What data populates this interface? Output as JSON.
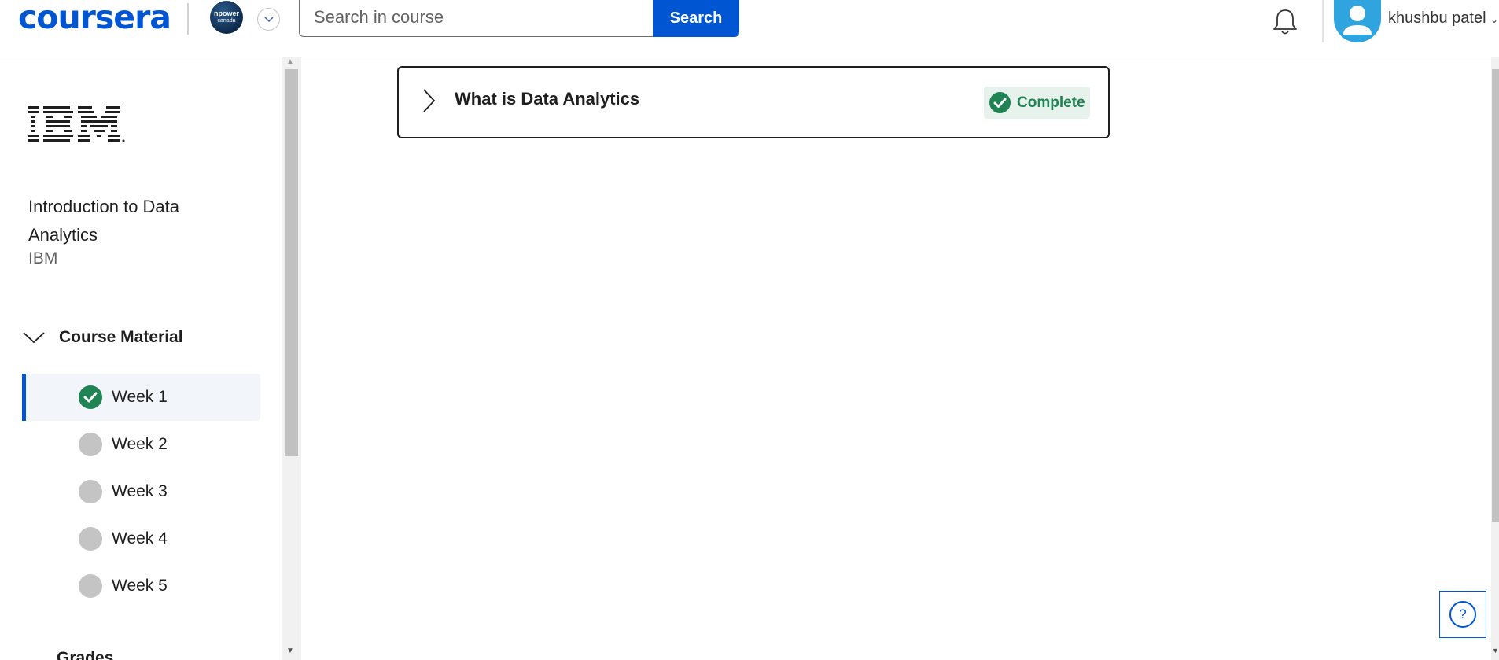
{
  "header": {
    "logo_text": "coursera",
    "partner_badge": {
      "line1": "npower",
      "line2": "canada"
    },
    "search": {
      "placeholder": "Search in course",
      "button_label": "Search"
    },
    "user": {
      "name": "khushbu patel"
    }
  },
  "sidebar": {
    "org_logo": "IBM",
    "course_title": "Introduction to Data Analytics",
    "course_org": "IBM",
    "section_label": "Course Material",
    "weeks": [
      {
        "label": "Week 1",
        "status": "complete"
      },
      {
        "label": "Week 2",
        "status": "incomplete"
      },
      {
        "label": "Week 3",
        "status": "incomplete"
      },
      {
        "label": "Week 4",
        "status": "incomplete"
      },
      {
        "label": "Week 5",
        "status": "incomplete"
      }
    ],
    "grades_label": "Grades"
  },
  "main": {
    "lesson": {
      "title": "What is Data Analytics",
      "status_label": "Complete"
    }
  },
  "help": {
    "glyph": "?"
  },
  "colors": {
    "brand": "#0056d2",
    "success": "#1f8354",
    "muted_dot": "#c4c4c4"
  }
}
